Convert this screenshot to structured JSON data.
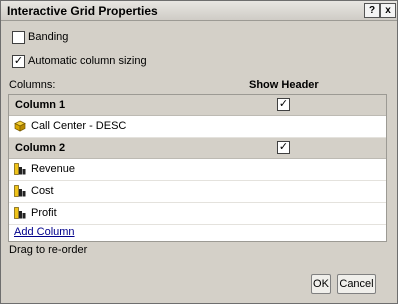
{
  "dialog": {
    "title": "Interactive Grid Properties",
    "help_label": "?",
    "close_label": "x"
  },
  "options": {
    "banding": {
      "label": "Banding",
      "checked": false
    },
    "auto_sizing": {
      "label": "Automatic column sizing",
      "checked": true
    }
  },
  "grid": {
    "columns_label": "Columns:",
    "show_header_label": "Show Header",
    "groups": [
      {
        "name": "Column 1",
        "show_header": true,
        "items": [
          {
            "label": "Call Center - DESC",
            "icon": "dimension-cube-icon"
          }
        ]
      },
      {
        "name": "Column 2",
        "show_header": true,
        "items": [
          {
            "label": "Revenue",
            "icon": "measure-icon"
          },
          {
            "label": "Cost",
            "icon": "measure-icon"
          },
          {
            "label": "Profit",
            "icon": "measure-icon"
          }
        ]
      }
    ],
    "add_column_label": "Add Column",
    "drag_hint": "Drag to re-order"
  },
  "buttons": {
    "ok": "OK",
    "cancel": "Cancel"
  },
  "check_glyph": "✓"
}
